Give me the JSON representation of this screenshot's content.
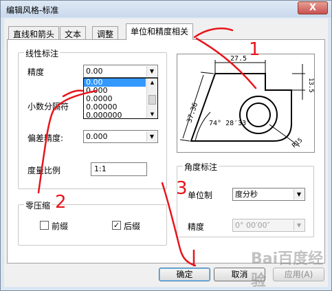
{
  "window": {
    "title": "编辑风格-标准",
    "close_label": "X"
  },
  "tabs": [
    "直线和箭头",
    "文本",
    "调整",
    "单位和精度相关"
  ],
  "linear": {
    "group_title": "线性标注",
    "precision_label": "精度",
    "precision_value": "0.00",
    "precision_options": [
      "0.00",
      "0.000",
      "0.0000",
      "0.00000",
      "0.000000"
    ],
    "decimal_sep_label": "小数分隔符",
    "tolerance_label": "偏差精度:",
    "tolerance_value": "0.000",
    "scale_label": "度量比例",
    "scale_value": "1:1"
  },
  "zero": {
    "group_title": "零压缩",
    "leading_label": "前缀",
    "leading_checked": "",
    "trailing_label": "后缀",
    "trailing_checked": "✓"
  },
  "angular": {
    "group_title": "角度标注",
    "unit_label": "单位制",
    "unit_value": "度分秒",
    "precision_label": "精度",
    "precision_value": "0° 00′00″"
  },
  "preview": {
    "dim_top": "27.5",
    "dim_right": "13.5",
    "dim_left": "37.36",
    "dim_angle": "74° 28′33″",
    "dim_radius": "R15"
  },
  "buttons": {
    "ok": "确定",
    "cancel": "取消",
    "apply": "应用(A)"
  },
  "annotations": {
    "n1": "1",
    "n2": "2",
    "n3": "3"
  },
  "watermark": "Bai百度经验"
}
